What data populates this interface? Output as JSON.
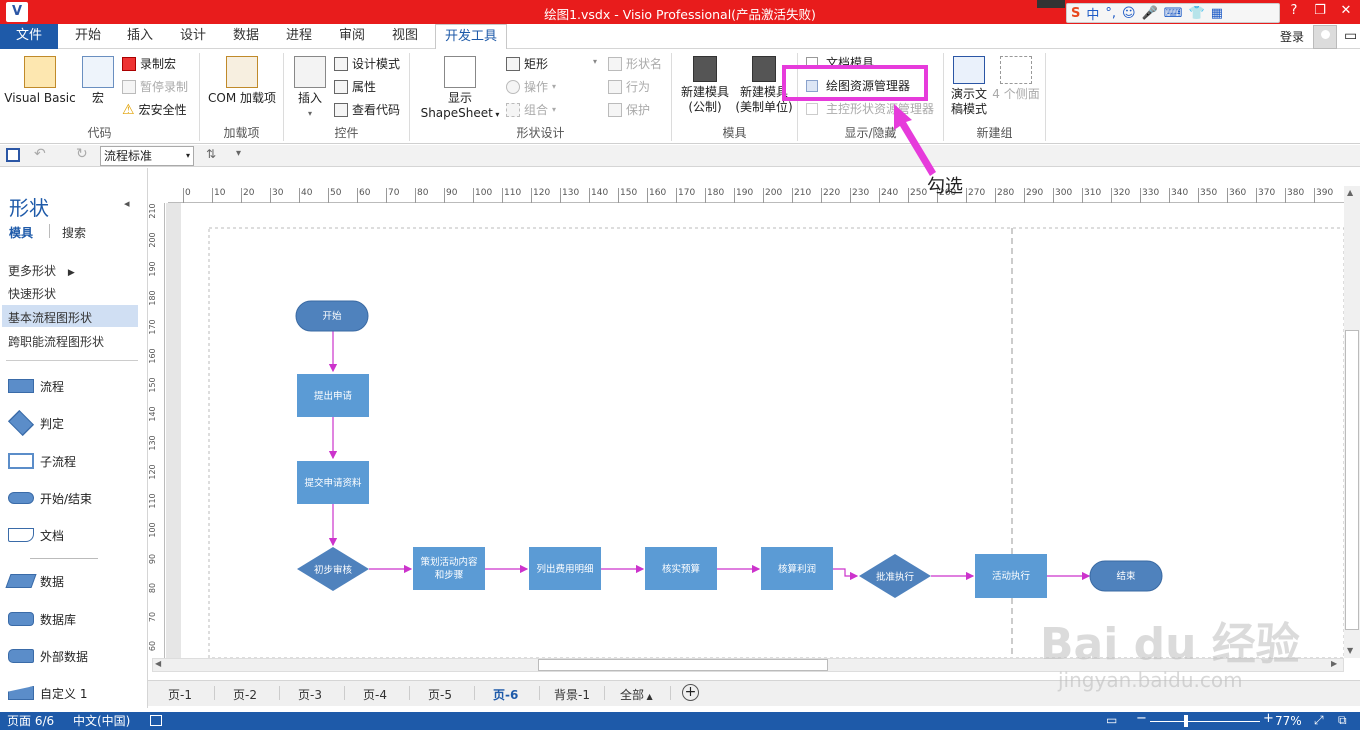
{
  "titlebar": {
    "title": "绘图1.vsdx - Visio Professional(产品激活失败)",
    "app_icon": "V"
  },
  "window_controls": {
    "help": "?",
    "restore": "❐",
    "close": "✕"
  },
  "ime": {
    "lang": "中"
  },
  "tabs": [
    "文件",
    "开始",
    "插入",
    "设计",
    "数据",
    "进程",
    "审阅",
    "视图",
    "开发工具"
  ],
  "account": {
    "signin": "登录"
  },
  "ribbon": {
    "code": {
      "label": "代码",
      "vb": "Visual Basic",
      "macro": "宏",
      "record": "录制宏",
      "pause": "暂停录制",
      "security": "宏安全性"
    },
    "addins": {
      "label": "加载项",
      "com": "COM 加载项"
    },
    "controls": {
      "label": "控件",
      "insert": "插入",
      "design_mode": "设计模式",
      "properties": "属性",
      "view_code": "查看代码"
    },
    "shape_design": {
      "label": "形状设计",
      "show": "显示",
      "shapesheet": "ShapeSheet",
      "rect": "矩形",
      "operation": "操作",
      "group": "组合",
      "shape_name": "形状名",
      "behavior": "行为",
      "protect": "保护"
    },
    "stencil": {
      "label": "模具",
      "new_metric_1": "新建模具",
      "new_metric_2": "(公制)",
      "new_us_1": "新建模具",
      "new_us_2": "(美制单位)"
    },
    "show_hide": {
      "label": "显示/隐藏",
      "doc_stencil": "文档模具",
      "drawing_explorer": "绘图资源管理器",
      "master_explorer": "主控形状资源管理器"
    },
    "new_group": {
      "label": "新建组",
      "present_1": "演示文",
      "present_2": "稿模式",
      "four_sides": "4 个侧面"
    }
  },
  "qat": {
    "theme_select": "流程标准"
  },
  "shapes_pane": {
    "title": "形状",
    "tab_stencil": "模具",
    "tab_search": "搜索",
    "nav": [
      "更多形状",
      "快速形状",
      "基本流程图形状",
      "跨职能流程图形状"
    ],
    "items": [
      "流程",
      "判定",
      "子流程",
      "开始/结束",
      "文档",
      "数据",
      "数据库",
      "外部数据",
      "自定义 1"
    ]
  },
  "ruler": {
    "h": [
      "0",
      "10",
      "20",
      "30",
      "40",
      "50",
      "60",
      "70",
      "80",
      "90",
      "100",
      "110",
      "120",
      "130",
      "140",
      "150",
      "160",
      "170",
      "180",
      "190",
      "200",
      "210",
      "220",
      "230",
      "240",
      "250",
      "260",
      "270",
      "280",
      "290",
      "300",
      "310",
      "320",
      "330",
      "340",
      "350",
      "360",
      "370",
      "380",
      "390"
    ],
    "v": [
      "210",
      "200",
      "190",
      "180",
      "170",
      "160",
      "150",
      "140",
      "130",
      "120",
      "110",
      "100",
      "90",
      "80",
      "70",
      "60"
    ]
  },
  "flowchart": {
    "start": "开始",
    "submit": "提出申请",
    "materials": "提交申请资料",
    "review": "初步审核",
    "plan": "策划活动内容和步骤",
    "cost": "列出费用明细",
    "budget": "核实预算",
    "profit": "核算利润",
    "approve": "批准执行",
    "execute": "活动执行",
    "end": "结束"
  },
  "page_tabs": [
    "页-1",
    "页-2",
    "页-3",
    "页-4",
    "页-5",
    "页-6",
    "背景-1",
    "全部"
  ],
  "status": {
    "page": "页面 6/6",
    "lang": "中文(中国)",
    "zoom": "77%"
  },
  "annotation": {
    "text": "勾选"
  },
  "watermark": {
    "logo": "Bai du 经验",
    "url": "jingyan.baidu.com"
  },
  "colors": {
    "title_bar": "#e81c1c",
    "accent": "#1e5aa9",
    "shape_fill": "#5b9bd5",
    "connector": "#cc33cc",
    "callout": "#e63bdb"
  }
}
